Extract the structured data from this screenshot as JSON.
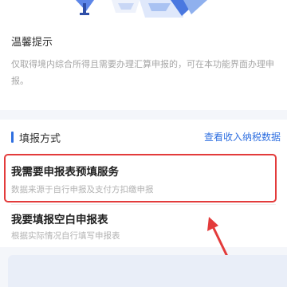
{
  "notice": {
    "title": "温馨提示",
    "body": "仅取得境内综合所得且需要办理汇算申报的，可在本功能界面办理申报。"
  },
  "section": {
    "title": "填报方式",
    "link": "查看收入纳税数据"
  },
  "options": [
    {
      "title": "我需要申报表预填服务",
      "desc": "数据来源于自行申报及支付方扣缴申报"
    },
    {
      "title": "我要填报空白申报表",
      "desc": "根据实际情况自行填写申报表"
    }
  ],
  "colors": {
    "accent": "#2f6fe0",
    "highlight": "#e33b3b"
  },
  "annotations": {
    "highlight_box": "red rectangle around first option",
    "arrow": "red arrow pointing to first option"
  }
}
